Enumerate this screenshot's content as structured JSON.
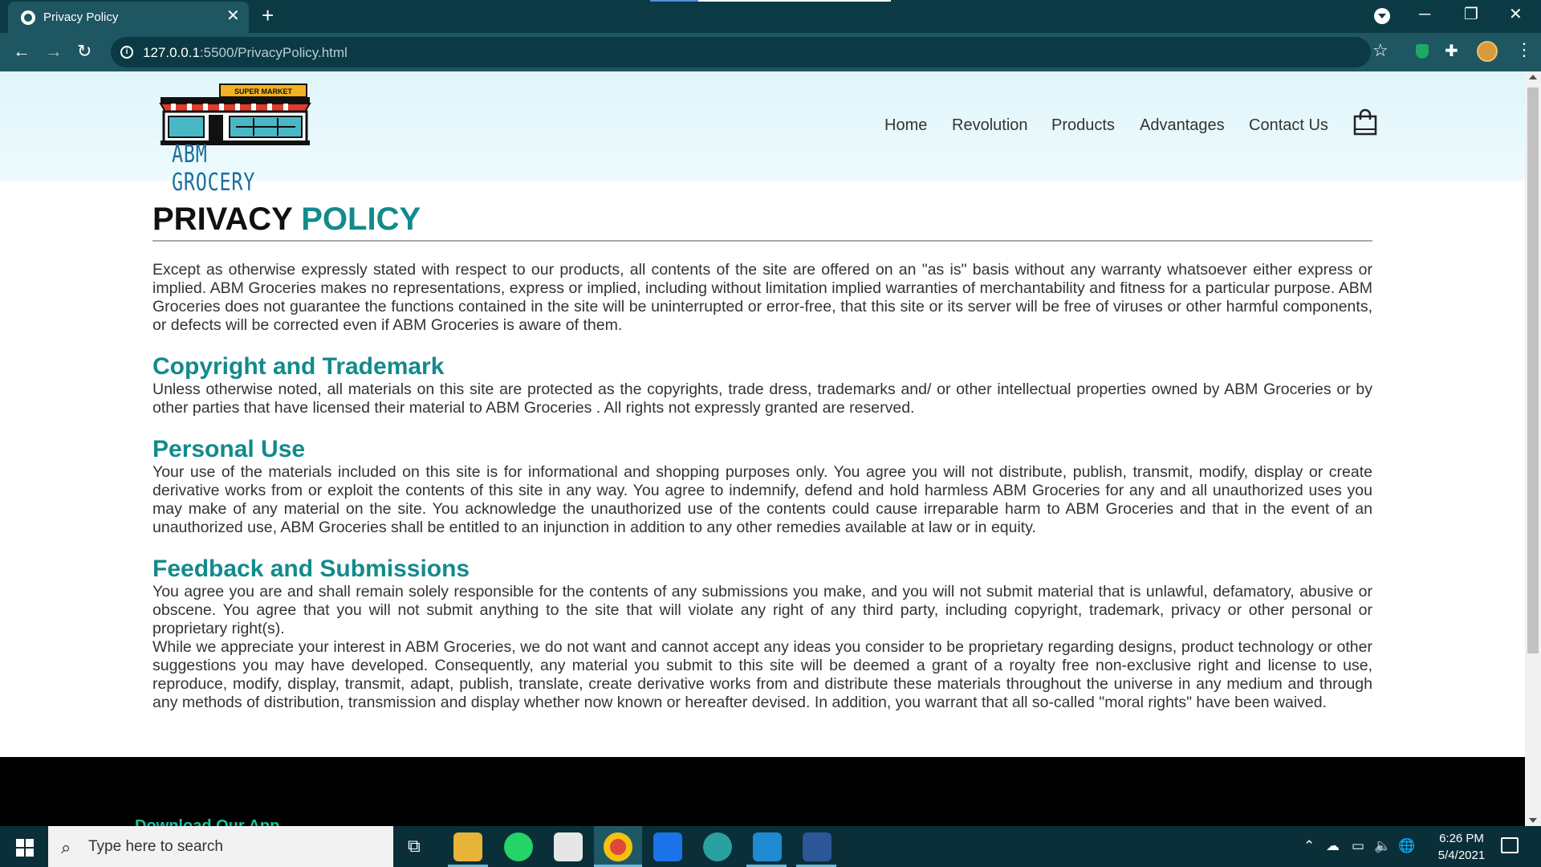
{
  "browser": {
    "tab_title": "Privacy Policy",
    "tab_close": "✕",
    "new_tab": "+",
    "url_host": "127.0.0.1",
    "url_rest": ":5500/PrivacyPolicy.html",
    "back": "←",
    "forward": "→",
    "reload": "↻",
    "star": "☆",
    "menu": "⋮",
    "minimize": "─",
    "restore": "❐",
    "close": "✕"
  },
  "site": {
    "logo_text": "ABM GROCERY",
    "logo_sign": "SUPER MARKET",
    "nav": [
      "Home",
      "Revolution",
      "Products",
      "Advantages",
      "Contact Us"
    ]
  },
  "policy": {
    "title_dark": "PRIVACY",
    "title_accent": "POLICY",
    "intro": "Except as otherwise expressly stated with respect to our products, all contents of the site are offered on an \"as is\" basis without any warranty whatsoever either express or implied. ABM Groceries makes no representations, express or implied, including without limitation implied warranties of merchantability and fitness for a particular purpose. ABM Groceries does not guarantee the functions contained in the site will be uninterrupted or error-free, that this site or its server will be free of viruses or other harmful components, or defects will be corrected even if ABM Groceries is aware of them.",
    "sections": [
      {
        "heading": "Copyright and Trademark",
        "paragraphs": [
          "Unless otherwise noted, all materials on this site are protected as the copyrights, trade dress, trademarks and/ or other intellectual properties owned by ABM Groceries or by other parties that have licensed their material to ABM Groceries . All rights not expressly granted are reserved."
        ]
      },
      {
        "heading": "Personal Use",
        "paragraphs": [
          "Your use of the materials included on this site is for informational and shopping purposes only. You agree you will not distribute, publish, transmit, modify, display or create derivative works from or exploit the contents of this site in any way. You agree to indemnify, defend and hold harmless ABM Groceries for any and all unauthorized uses you may make of any material on the site. You acknowledge the unauthorized use of the contents could cause irreparable harm to ABM Groceries and that in the event of an unauthorized use, ABM Groceries shall be entitled to an injunction in addition to any other remedies available at law or in equity."
        ]
      },
      {
        "heading": "Feedback and Submissions",
        "paragraphs": [
          "You agree you are and shall remain solely responsible for the contents of any submissions you make, and you will not submit material that is unlawful, defamatory, abusive or obscene. You agree that you will not submit anything to the site that will violate any right of any third party, including copyright, trademark, privacy or other personal or proprietary right(s).",
          "While we appreciate your interest in ABM Groceries, we do not want and cannot accept any ideas you consider to be proprietary regarding designs, product technology or other suggestions you may have developed. Consequently, any material you submit to this site will be deemed a grant of a royalty free non-exclusive right and license to use, reproduce, modify, display, transmit, adapt, publish, translate, create derivative works from and distribute these materials throughout the universe in any medium and through any methods of distribution, transmission and display whether now known or hereafter devised. In addition, you warrant that all so-called \"moral rights\" have been waived."
        ]
      }
    ]
  },
  "footer": {
    "download_app": "Download Our App"
  },
  "taskbar": {
    "search_placeholder": "Type here to search",
    "time": "6:26 PM",
    "date": "5/4/2021"
  },
  "colors": {
    "accent": "#138a8c",
    "chrome_dark": "#0b3a44",
    "chrome_tab": "#1e5662",
    "header_bg": "#dff5fb"
  }
}
